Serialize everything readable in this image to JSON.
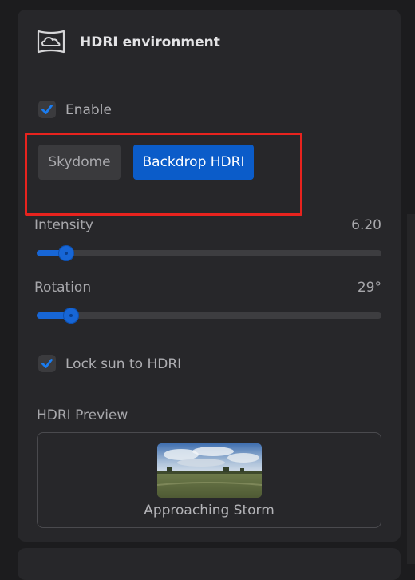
{
  "panel": {
    "title": "HDRI environment",
    "header_icon": "cloud-environment-icon"
  },
  "enable": {
    "label": "Enable",
    "checked": true
  },
  "mode": {
    "options": [
      "Skydome",
      "Backdrop HDRI"
    ],
    "selected": "Backdrop HDRI"
  },
  "intensity": {
    "label": "Intensity",
    "value_text": "6.20",
    "fraction": 0.085
  },
  "rotation": {
    "label": "Rotation",
    "value_text": "29°",
    "fraction": 0.1
  },
  "lock_sun": {
    "label": "Lock sun to HDRI",
    "checked": true
  },
  "preview": {
    "title": "HDRI Preview",
    "name": "Approaching Storm"
  },
  "colors": {
    "accent": "#1766d6",
    "selected_button": "#0b5cc9",
    "highlight": "#e8231e"
  }
}
